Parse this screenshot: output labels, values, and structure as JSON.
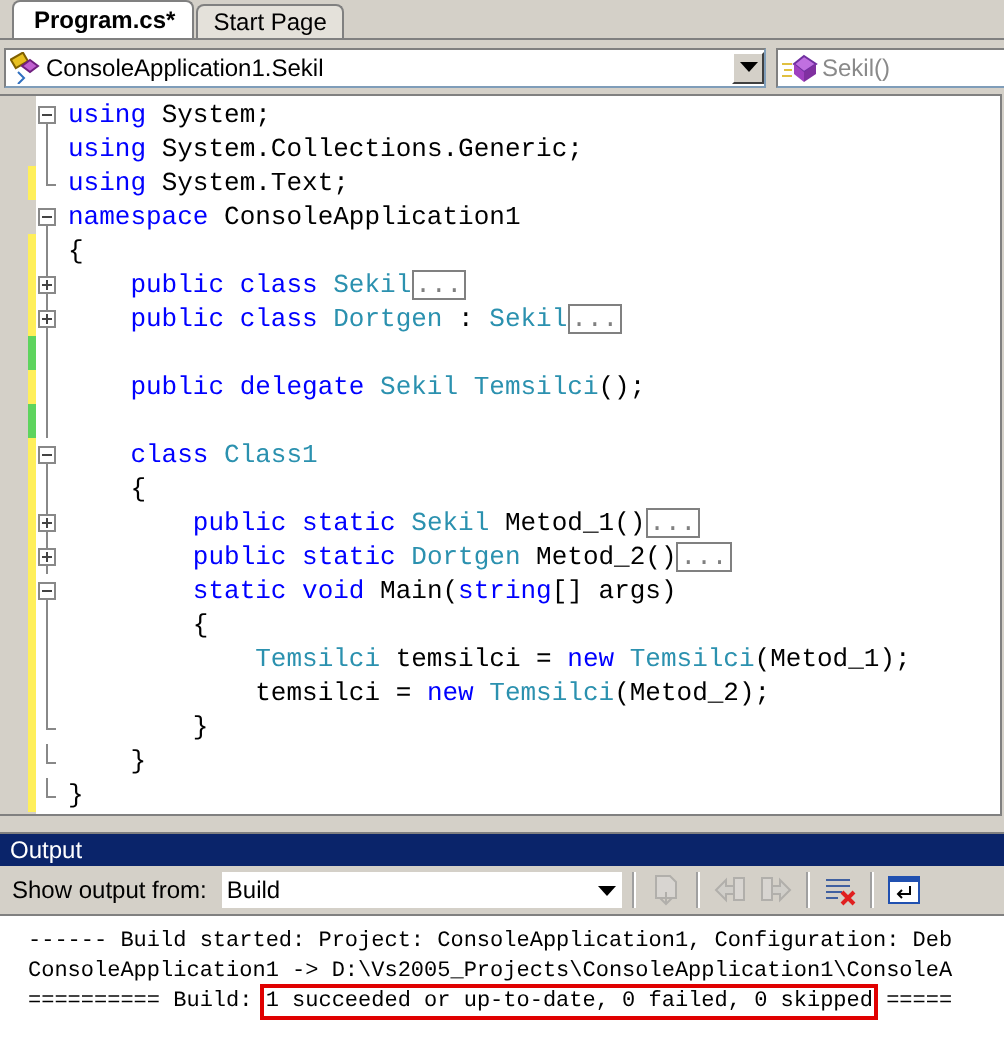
{
  "tabs": [
    {
      "label": "Program.cs*",
      "selected": true
    },
    {
      "label": "Start Page",
      "selected": false
    }
  ],
  "navigation": {
    "type_combo": {
      "value": "ConsoleApplication1.Sekil"
    },
    "member_combo": {
      "value": "Sekil()",
      "disabled": true
    }
  },
  "editor": {
    "lines": [
      {
        "kind": "block-start",
        "changed": false,
        "tokens": [
          {
            "text": "using",
            "kind": "keyword"
          },
          {
            "text": " System;",
            "kind": "plain"
          }
        ]
      },
      {
        "kind": "block-body",
        "changed": false,
        "tokens": [
          {
            "text": "using",
            "kind": "keyword"
          },
          {
            "text": " System.Collections.Generic;",
            "kind": "plain"
          }
        ]
      },
      {
        "kind": "block-end",
        "changed": true,
        "saved": false,
        "tokens": [
          {
            "text": "using",
            "kind": "keyword"
          },
          {
            "text": " System.Text;",
            "kind": "plain"
          }
        ]
      },
      {
        "kind": "block-start",
        "changed": false,
        "tokens": [
          {
            "text": "namespace",
            "kind": "keyword"
          },
          {
            "text": " ConsoleApplication1",
            "kind": "plain"
          }
        ]
      },
      {
        "kind": "block-body",
        "changed": true,
        "saved": false,
        "tokens": [
          {
            "text": "{",
            "kind": "plain"
          }
        ]
      },
      {
        "kind": "collapsed",
        "changed": true,
        "saved": false,
        "tokens": [
          {
            "text": "    public class ",
            "kind": "keyword"
          },
          {
            "text": "Sekil",
            "kind": "type"
          },
          {
            "text": "...",
            "kind": "folded"
          }
        ]
      },
      {
        "kind": "collapsed",
        "changed": true,
        "saved": false,
        "tokens": [
          {
            "text": "    public class ",
            "kind": "keyword"
          },
          {
            "text": "Dortgen",
            "kind": "type"
          },
          {
            "text": " : ",
            "kind": "plain"
          },
          {
            "text": "Sekil",
            "kind": "type"
          },
          {
            "text": "...",
            "kind": "folded"
          }
        ]
      },
      {
        "kind": "block-body",
        "changed": true,
        "saved": true
      },
      {
        "kind": "block-body",
        "changed": true,
        "saved": false,
        "tokens": [
          {
            "text": "    public delegate ",
            "kind": "keyword"
          },
          {
            "text": "Sekil Temsilci",
            "kind": "type"
          },
          {
            "text": "();",
            "kind": "plain"
          }
        ]
      },
      {
        "kind": "block-body",
        "changed": true,
        "saved": true
      },
      {
        "kind": "block-start",
        "changed": true,
        "saved": false,
        "tokens": [
          {
            "text": "    class ",
            "kind": "keyword"
          },
          {
            "text": "Class1",
            "kind": "type"
          }
        ]
      },
      {
        "kind": "block-body",
        "changed": true,
        "saved": false,
        "tokens": [
          {
            "text": "    {",
            "kind": "plain"
          }
        ]
      },
      {
        "kind": "collapsed",
        "changed": true,
        "saved": false,
        "tokens": [
          {
            "text": "        public static ",
            "kind": "keyword"
          },
          {
            "text": "Sekil",
            "kind": "type"
          },
          {
            "text": " Metod_1()",
            "kind": "plain"
          },
          {
            "text": "...",
            "kind": "folded"
          }
        ]
      },
      {
        "kind": "collapsed",
        "changed": true,
        "saved": false,
        "tokens": [
          {
            "text": "        public static ",
            "kind": "keyword"
          },
          {
            "text": "Dortgen",
            "kind": "type"
          },
          {
            "text": " Metod_2()",
            "kind": "plain"
          },
          {
            "text": "...",
            "kind": "folded"
          }
        ]
      },
      {
        "kind": "block-start",
        "changed": true,
        "saved": false,
        "tokens": [
          {
            "text": "        static void",
            "kind": "keyword"
          },
          {
            "text": " Main(",
            "kind": "plain"
          },
          {
            "text": "string",
            "kind": "keyword"
          },
          {
            "text": "[] args)",
            "kind": "plain"
          }
        ]
      },
      {
        "kind": "block-body",
        "changed": true,
        "saved": false,
        "tokens": [
          {
            "text": "        {",
            "kind": "plain"
          }
        ]
      },
      {
        "kind": "block-body",
        "changed": true,
        "saved": false,
        "tokens": [
          {
            "text": "            Temsilci",
            "kind": "type"
          },
          {
            "text": " temsilci = ",
            "kind": "plain"
          },
          {
            "text": "new ",
            "kind": "keyword"
          },
          {
            "text": "Temsilci",
            "kind": "type"
          },
          {
            "text": "(Metod_1);",
            "kind": "plain"
          }
        ]
      },
      {
        "kind": "block-body",
        "changed": true,
        "saved": false,
        "tokens": [
          {
            "text": "            temsilci = ",
            "kind": "plain"
          },
          {
            "text": "new ",
            "kind": "keyword"
          },
          {
            "text": "Temsilci",
            "kind": "type"
          },
          {
            "text": "(Metod_2);",
            "kind": "plain"
          }
        ]
      },
      {
        "kind": "block-end",
        "changed": true,
        "saved": false,
        "tokens": [
          {
            "text": "        }",
            "kind": "plain"
          }
        ]
      },
      {
        "kind": "block-end",
        "changed": true,
        "saved": false,
        "tokens": [
          {
            "text": "    }",
            "kind": "plain"
          }
        ]
      },
      {
        "kind": "block-end",
        "changed": true,
        "saved": false,
        "tokens": [
          {
            "text": "}",
            "kind": "plain"
          }
        ]
      }
    ]
  },
  "output": {
    "title": "Output",
    "source_label": "Show output from:",
    "source": "Build",
    "toolbar": [
      {
        "kind": "find",
        "disabled": true
      },
      {
        "kind": "previous",
        "disabled": true
      },
      {
        "kind": "next",
        "disabled": true
      },
      {
        "kind": "clear",
        "disabled": false
      },
      {
        "kind": "wrap",
        "disabled": false
      }
    ],
    "lines": [
      {
        "segments": [
          {
            "text": "------ Build started: Project: ConsoleApplication1, Configuration: Deb",
            "highlighted": false
          }
        ]
      },
      {
        "segments": [
          {
            "text": "ConsoleApplication1 -> D:\\Vs2005_Projects\\ConsoleApplication1\\ConsoleA",
            "highlighted": false
          }
        ]
      },
      {
        "segments": [
          {
            "text": "========== Build: ",
            "highlighted": false
          },
          {
            "text": "1 succeeded or up-to-date, 0 failed, 0 skipped",
            "highlighted": true
          },
          {
            "text": " =====",
            "highlighted": false
          }
        ]
      }
    ]
  }
}
